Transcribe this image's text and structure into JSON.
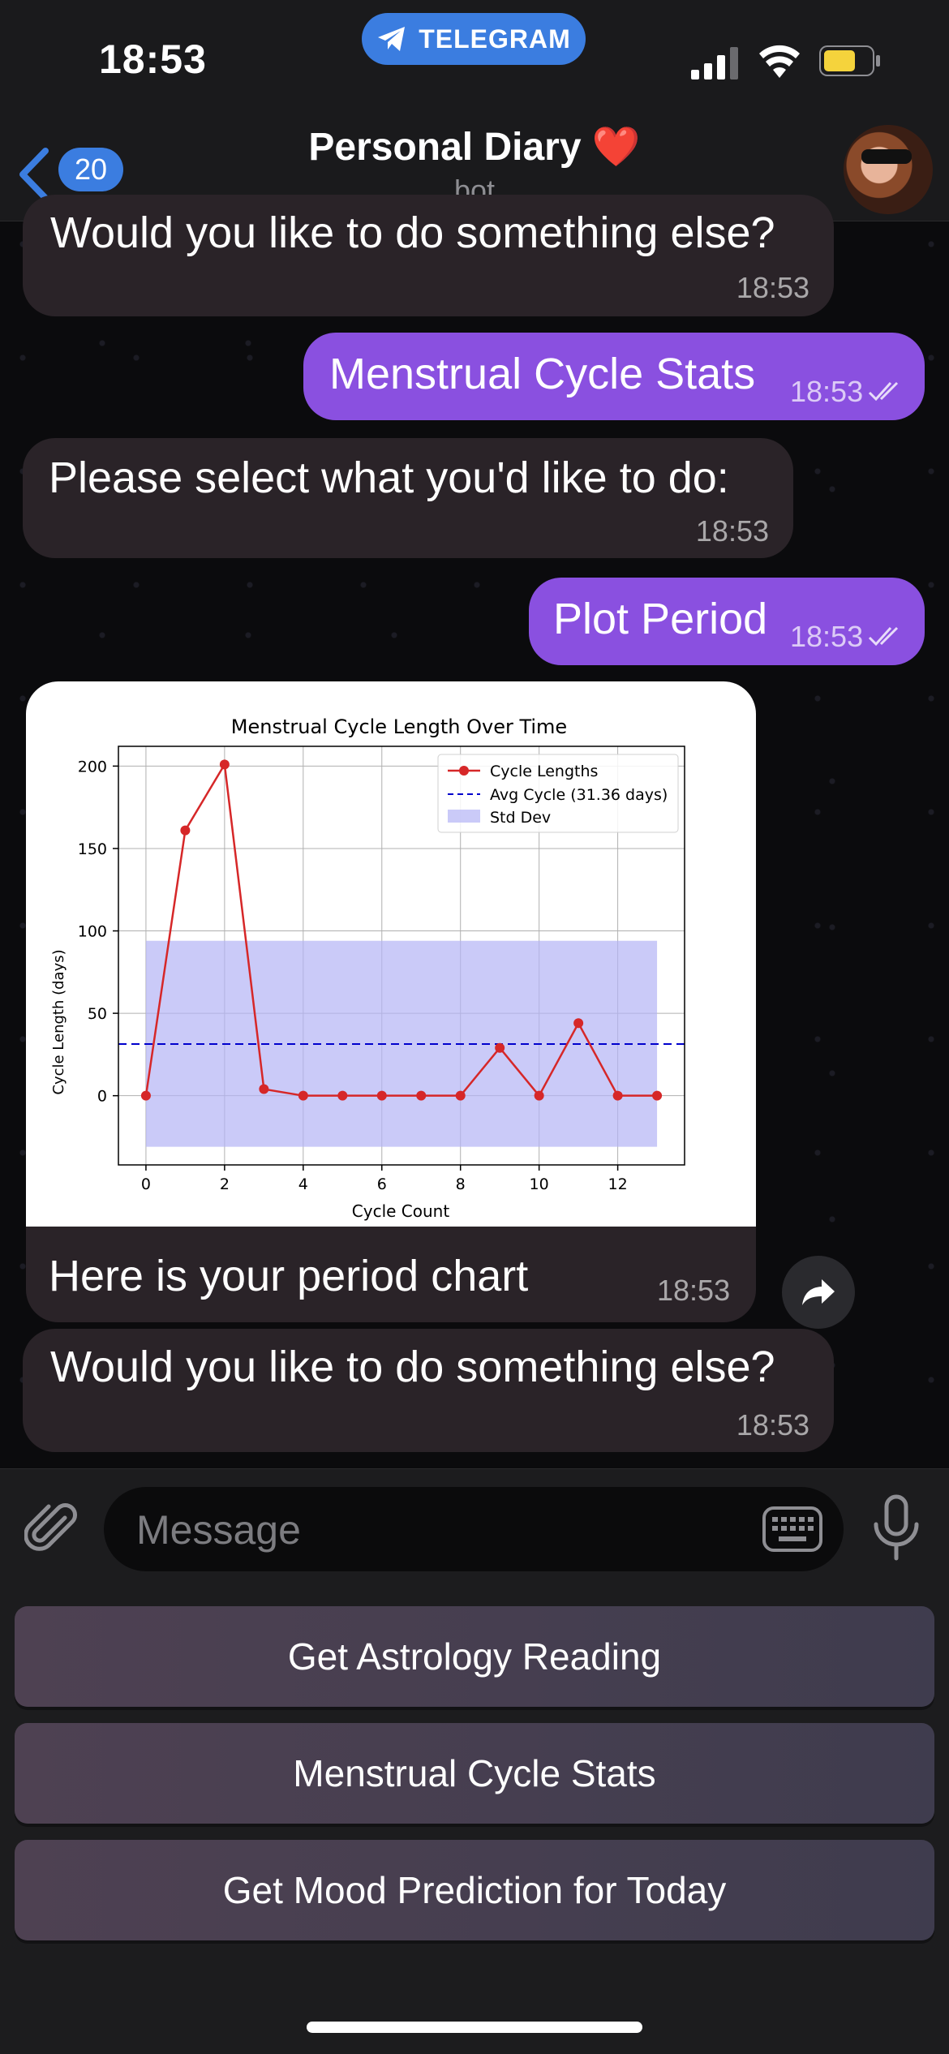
{
  "status_bar": {
    "time": "18:53",
    "app_pill": "TELEGRAM"
  },
  "header": {
    "unread_count": "20",
    "title": "Personal Diary ❤️",
    "subtitle": "bot"
  },
  "messages": [
    {
      "side": "in",
      "text": "Would you like to do something else?",
      "time": "18:53"
    },
    {
      "side": "out",
      "text": "Menstrual Cycle Stats",
      "time": "18:53"
    },
    {
      "side": "in",
      "text": "Please select what you'd like to do:",
      "time": "18:53"
    },
    {
      "side": "out",
      "text": "Plot Period",
      "time": "18:53"
    },
    {
      "side": "in",
      "text": "Here is your period chart",
      "time": "18:53"
    },
    {
      "side": "in",
      "text": "Would you like to do something else?",
      "time": "18:53"
    }
  ],
  "chart_data": {
    "type": "line",
    "title": "Menstrual Cycle Length Over Time",
    "xlabel": "Cycle Count",
    "ylabel": "Cycle Length (days)",
    "xlim": [
      -0.7,
      13.7
    ],
    "ylim": [
      -42,
      212
    ],
    "xticks": [
      0,
      2,
      4,
      6,
      8,
      10,
      12
    ],
    "yticks": [
      0,
      50,
      100,
      150,
      200
    ],
    "grid": true,
    "legend_position": "top-right",
    "series": [
      {
        "name": "Cycle Lengths",
        "color": "#d62728",
        "x": [
          0,
          1,
          2,
          3,
          4,
          5,
          6,
          7,
          8,
          9,
          10,
          11,
          12,
          13
        ],
        "values": [
          0,
          161,
          201,
          4,
          0,
          0,
          0,
          0,
          0,
          29,
          0,
          44,
          0,
          0
        ]
      }
    ],
    "average": {
      "name": "Avg Cycle (31.36 days)",
      "value": 31.36,
      "color": "#0000cc"
    },
    "std_band": {
      "name": "Std Dev",
      "low": -31,
      "high": 94,
      "x_range": [
        0,
        13
      ],
      "color": "#b3b3f5"
    }
  },
  "input": {
    "placeholder": "Message"
  },
  "keyboard": [
    {
      "label": "Get Astrology Reading"
    },
    {
      "label": "Menstrual Cycle Stats"
    },
    {
      "label": "Get Mood Prediction for Today"
    }
  ]
}
